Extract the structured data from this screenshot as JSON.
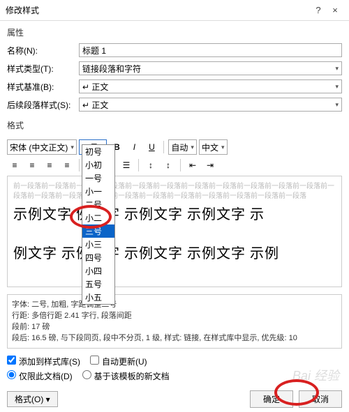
{
  "titlebar": {
    "title": "修改样式",
    "help": "?",
    "close": "×"
  },
  "labels": {
    "props": "属性",
    "name": "名称(N):",
    "type": "样式类型(T):",
    "base": "样式基准(B):",
    "next": "后续段落样式(S):",
    "format": "格式"
  },
  "fields": {
    "name": "标题 1",
    "type": "链接段落和字符",
    "base": "↵ 正文",
    "next": "↵ 正文"
  },
  "toolbar": {
    "font": "宋体 (中文正文)",
    "size": "二号",
    "auto": "自动",
    "lang": "中文"
  },
  "sizeOptions": [
    "初号",
    "小初",
    "一号",
    "小一",
    "二号",
    "小二",
    "三号",
    "小三",
    "四号",
    "小四",
    "五号",
    "小五"
  ],
  "selectedSize": "三号",
  "grey": "前一段落前一段落前一段落前一段落前一段落前一段落前一段落前一段落前一段落前一段落前一段落前一段落前一段落前一段落前一段落前一段落前一段落前一段落前一段落前一段落前一段落前一段落",
  "sample1": "示例文字    例文字 示例文字 示例文字 示",
  "sample2": "例文字 示例文字 示例文字 示例文字 示例",
  "desc": {
    "l1": "字体: 二号, 加粗, 字距调整二号",
    "l2": "行距: 多倍行距 2.41 字行, 段落间距",
    "l3": "段前: 17 磅",
    "l4": "段后: 16.5 磅, 与下段同页, 段中不分页, 1 级, 样式: 链接, 在样式库中显示, 优先级: 10"
  },
  "opts": {
    "addlib": "添加到样式库(S)",
    "autoupd": "自动更新(U)",
    "docOnly": "仅限此文档(D)",
    "template": "基于该模板的新文档"
  },
  "footer": {
    "format": "格式(O) ▾",
    "ok": "确定",
    "cancel": "取消"
  },
  "watermark": "Bai 经验"
}
